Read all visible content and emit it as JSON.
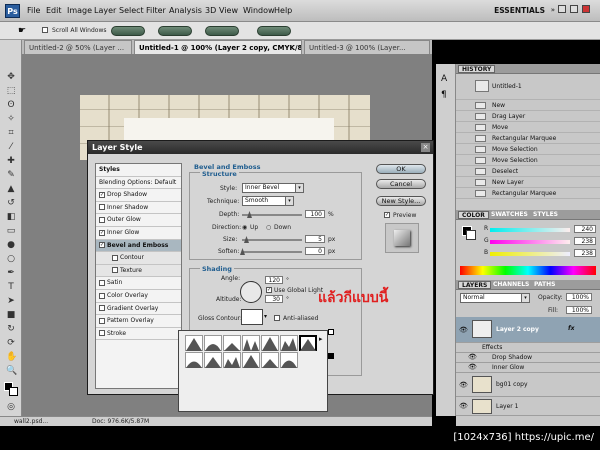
{
  "app": {
    "logo": "Ps",
    "workspace": "ESSENTIALS"
  },
  "menu": [
    "File",
    "Edit",
    "Image",
    "Layer",
    "Select",
    "Filter",
    "Analysis",
    "3D",
    "View",
    "Window",
    "Help"
  ],
  "options": {
    "scroll_all": "Scroll All Windows"
  },
  "tabs": [
    "Untitled-2 @ 50% (Layer ...",
    "Untitled-1 @ 100% (Layer 2 copy, CMYK/8) *",
    "Untitled-3 @ 100% (Layer..."
  ],
  "status": {
    "file": "wall2.psd...",
    "doc": "Doc: 976.6K/5.87M"
  },
  "dialog": {
    "title": "Layer Style",
    "styles_header": "Styles",
    "blending": "Blending Options: Default",
    "items": [
      {
        "label": "Drop Shadow",
        "checked": true
      },
      {
        "label": "Inner Shadow",
        "checked": false
      },
      {
        "label": "Outer Glow",
        "checked": false
      },
      {
        "label": "Inner Glow",
        "checked": true
      },
      {
        "label": "Bevel and Emboss",
        "checked": true
      },
      {
        "label": "Contour",
        "checked": false
      },
      {
        "label": "Texture",
        "checked": false
      },
      {
        "label": "Satin",
        "checked": false
      },
      {
        "label": "Color Overlay",
        "checked": false
      },
      {
        "label": "Gradient Overlay",
        "checked": false
      },
      {
        "label": "Pattern Overlay",
        "checked": false
      },
      {
        "label": "Stroke",
        "checked": false
      }
    ],
    "section": "Bevel and Emboss",
    "structure": "Structure",
    "style_label": "Style:",
    "style_value": "Inner Bevel",
    "technique_label": "Technique:",
    "technique_value": "Smooth",
    "depth_label": "Depth:",
    "depth_value": "100",
    "depth_unit": "%",
    "direction_label": "Direction:",
    "up": "Up",
    "down": "Down",
    "size_label": "Size:",
    "size_value": "5",
    "size_unit": "px",
    "soften_label": "Soften:",
    "soften_value": "0",
    "soften_unit": "px",
    "shading": "Shading",
    "angle_label": "Angle:",
    "angle_value": "120",
    "angle_unit": "°",
    "global_light": "Use Global Light",
    "altitude_label": "Altitude:",
    "altitude_value": "30",
    "altitude_unit": "°",
    "gloss_label": "Gloss Contour:",
    "anti_aliased": "Anti-aliased",
    "ok": "OK",
    "reset": "Cancel",
    "new_style": "New Style...",
    "preview": "Preview"
  },
  "annotation": "แล้วกีแบบนี้",
  "history": {
    "tab": "HISTORY",
    "snapshot": "Untitled-1",
    "items": [
      "New",
      "Drag Layer",
      "Move",
      "Rectangular Marquee",
      "Move Selection",
      "Move Selection",
      "Deselect",
      "New Layer",
      "Rectangular Marquee"
    ]
  },
  "color": {
    "tabs": [
      "COLOR",
      "SWATCHES",
      "STYLES"
    ],
    "r": "R",
    "g": "G",
    "b": "B",
    "r_val": "240",
    "g_val": "238",
    "b_val": "238"
  },
  "layers": {
    "tabs": [
      "LAYERS",
      "CHANNELS",
      "PATHS"
    ],
    "mode": "Normal",
    "opacity_label": "Opacity:",
    "opacity": "100%",
    "fill_label": "Fill:",
    "fill": "100%",
    "items": [
      "Layer 2 copy",
      "Effects",
      "Drop Shadow",
      "Inner Glow",
      "bg01 copy",
      "Layer 1"
    ],
    "fx": "fx"
  },
  "watermark": "[1024x736] https://upic.me/"
}
